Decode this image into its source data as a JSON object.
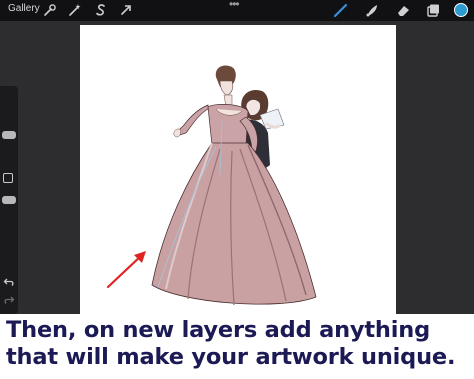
{
  "toolbar": {
    "gallery_label": "Gallery",
    "left_icons": [
      "wrench-icon",
      "magic-wand-icon",
      "selection-s-icon",
      "transform-arrow-icon"
    ],
    "right_icons": [
      "brush-icon",
      "smudge-icon",
      "eraser-icon",
      "layers-icon"
    ],
    "more_label": "•••",
    "current_color": "#2e9bd0"
  },
  "sidebar": {
    "icons": [
      "brush-size-slider",
      "modify-square-icon",
      "opacity-slider",
      "undo-icon",
      "redo-icon"
    ]
  },
  "canvas": {
    "background": "#ffffff",
    "annotation_arrow_color": "#e02424"
  },
  "caption": {
    "line1": "Then, on new layers add anything",
    "line2": "that will make your artwork unique.",
    "color": "#1b1a55"
  }
}
